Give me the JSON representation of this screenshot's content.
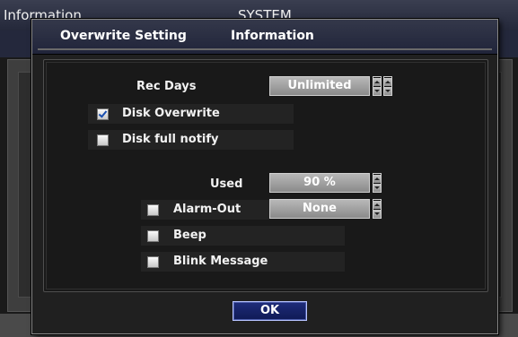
{
  "background": {
    "title_left": "Information",
    "title_center": "SYSTEM"
  },
  "dialog": {
    "tabs": [
      "Overwrite Setting",
      "Information"
    ],
    "rec_days": {
      "label": "Rec Days",
      "value": "Unlimited"
    },
    "disk_overwrite": {
      "label": "Disk Overwrite",
      "checked": true
    },
    "disk_full_notify": {
      "label": "Disk full notify",
      "checked": false
    },
    "used": {
      "label": "Used",
      "value": "90 %"
    },
    "alarm_out": {
      "label": "Alarm-Out",
      "value": "None",
      "checked": false
    },
    "beep": {
      "label": "Beep",
      "checked": false
    },
    "blink_message": {
      "label": "Blink Message",
      "checked": false
    },
    "ok_label": "OK"
  }
}
